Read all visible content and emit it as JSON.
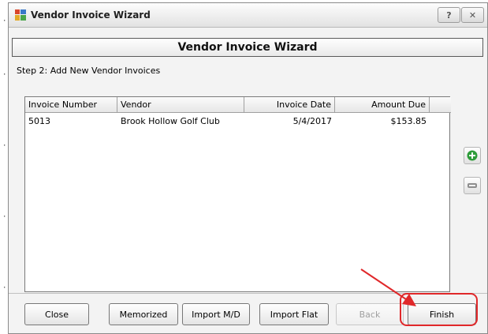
{
  "window": {
    "title": "Vendor Invoice Wizard",
    "help_label": "?",
    "close_label": "✕"
  },
  "wizard": {
    "header": "Vendor Invoice Wizard",
    "step": "Step 2: Add New Vendor Invoices"
  },
  "table": {
    "columns": [
      "Invoice Number",
      "Vendor",
      "Invoice Date",
      "Amount Due"
    ],
    "rows": [
      {
        "invoice_number": "5013",
        "vendor": "Brook Hollow Golf Club",
        "invoice_date": "5/4/2017",
        "amount_due": "$153.85"
      }
    ]
  },
  "side_buttons": {
    "add_icon": "plus-icon",
    "remove_icon": "minus-icon"
  },
  "footer": {
    "close": "Close",
    "memorized": "Memorized",
    "import_md": "Import M/D",
    "import_flat": "Import Flat",
    "back": "Back",
    "finish": "Finish"
  },
  "colors": {
    "annotation": "#e0282a",
    "add_green": "#2e9c3a"
  }
}
